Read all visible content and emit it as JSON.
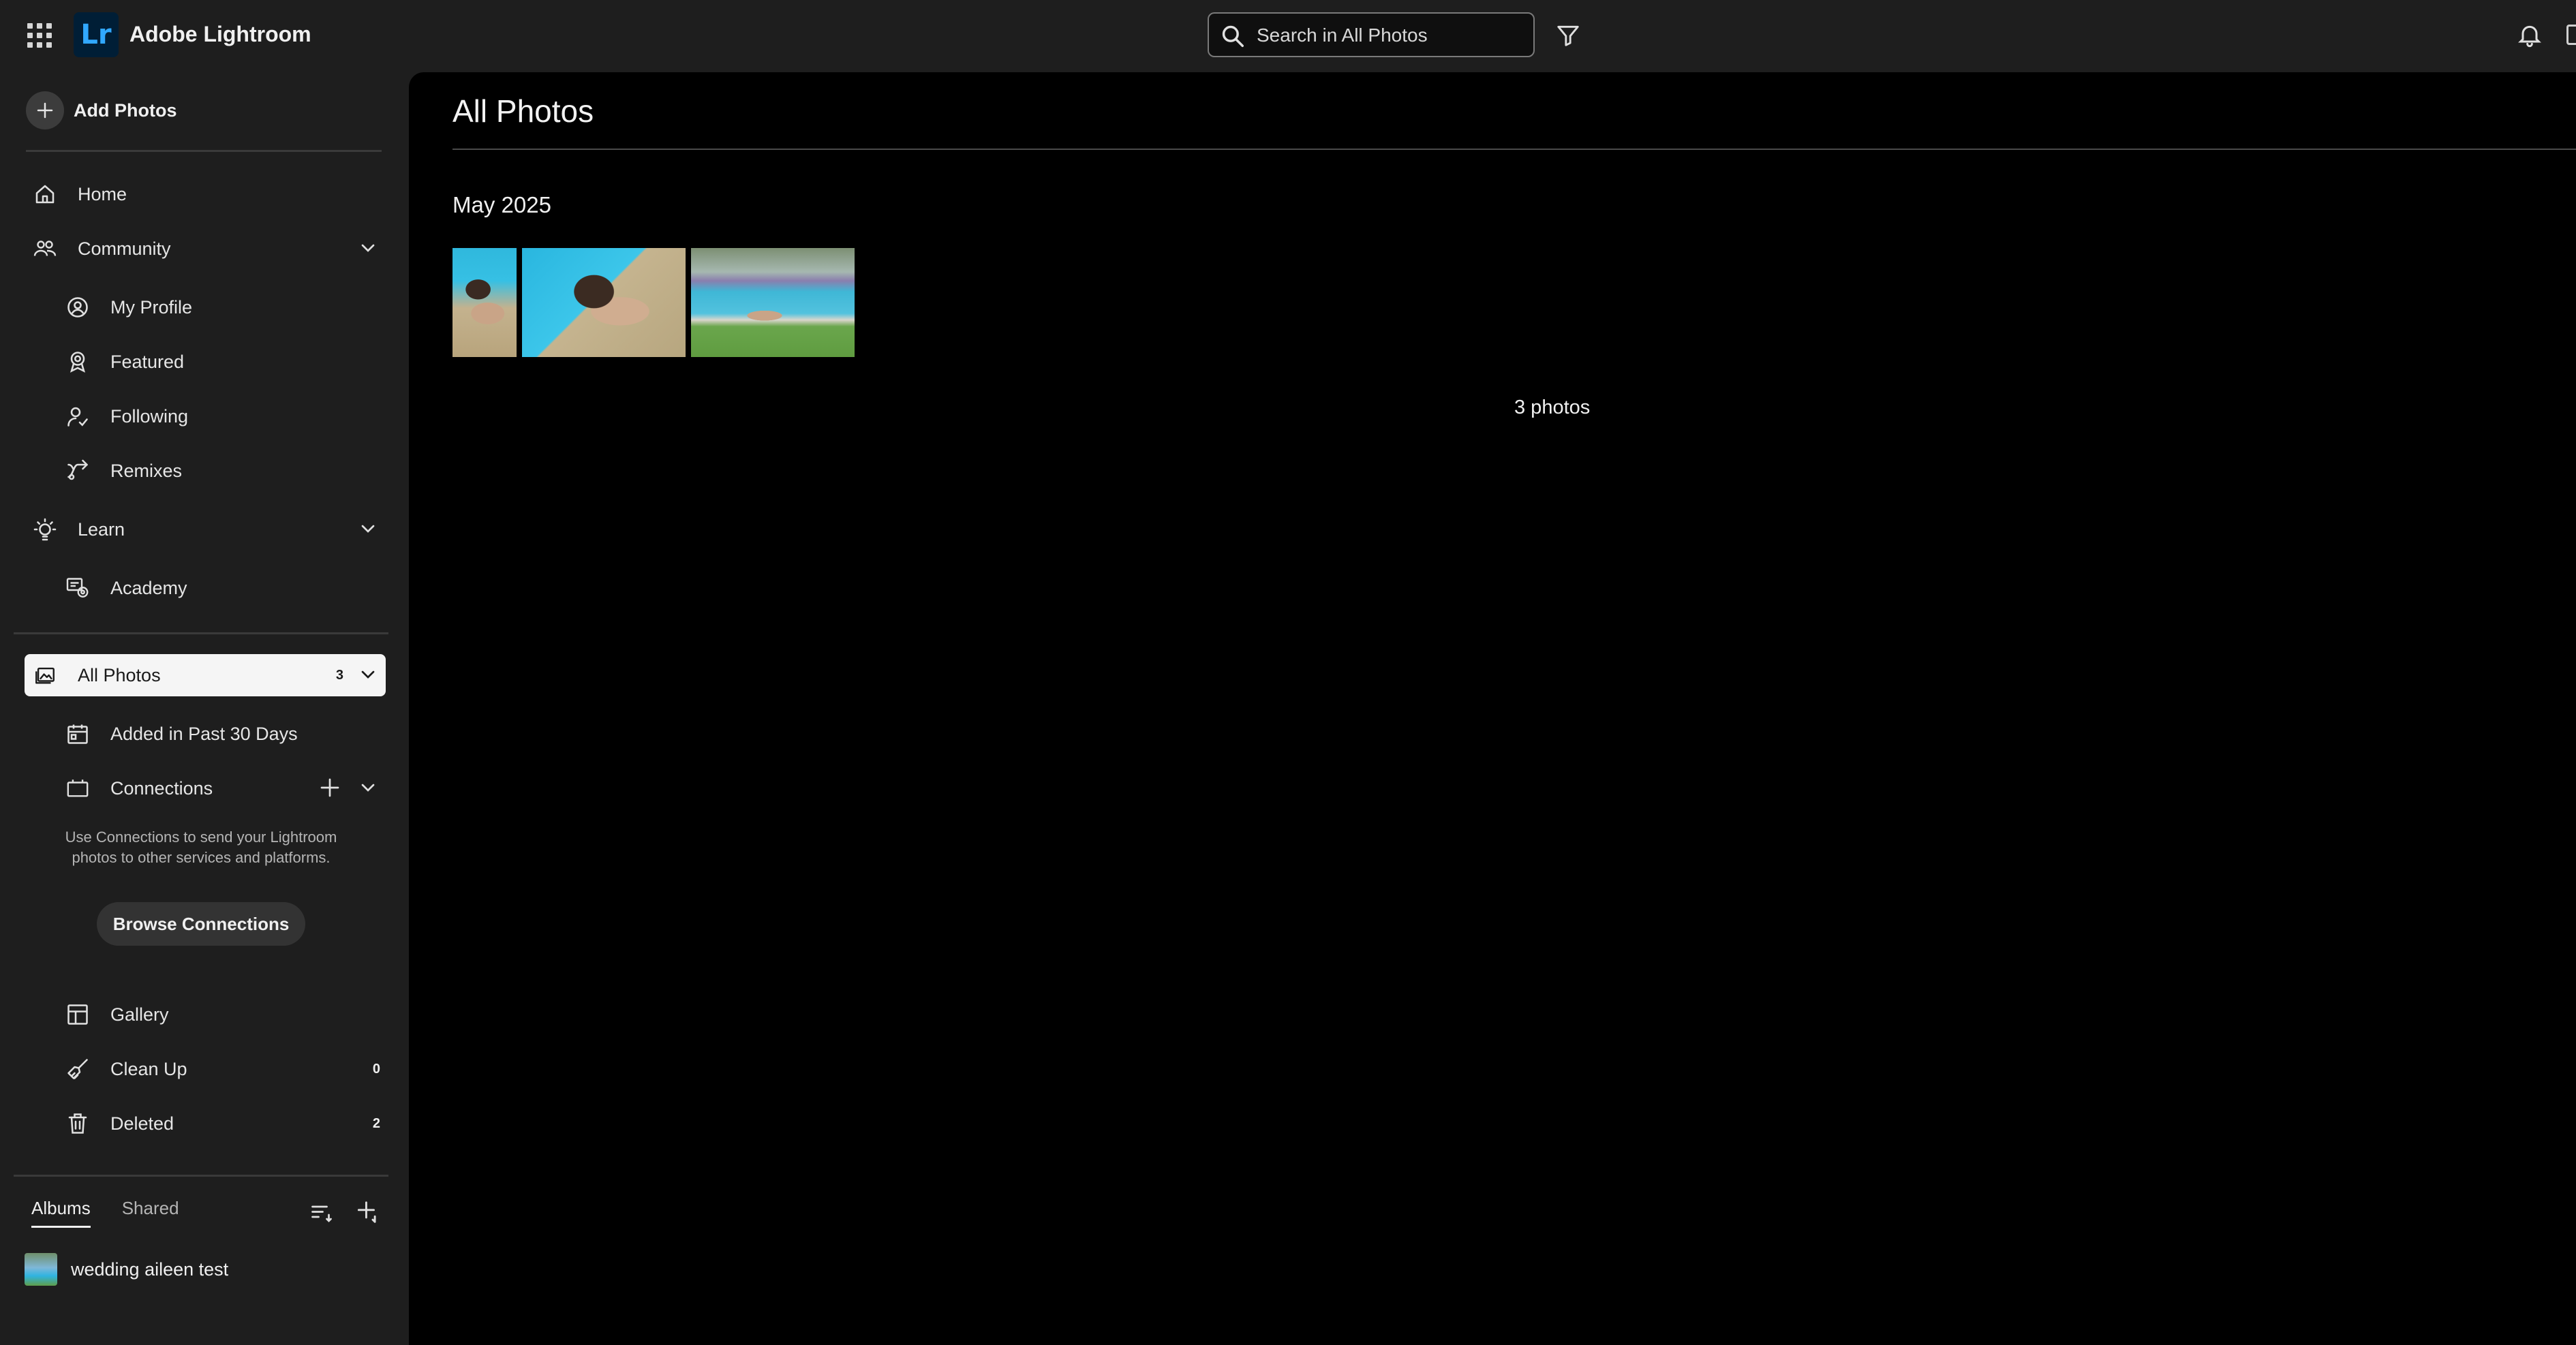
{
  "app": {
    "title": "Adobe Lightroom",
    "logo_text": "Lr"
  },
  "search": {
    "placeholder": "Search in All Photos"
  },
  "sidebar": {
    "add_photos": "Add Photos",
    "nav": {
      "home": "Home",
      "community": "Community",
      "my_profile": "My Profile",
      "featured": "Featured",
      "following": "Following",
      "remixes": "Remixes",
      "learn": "Learn",
      "academy": "Academy"
    },
    "library": {
      "all_photos": "All Photos",
      "all_photos_count": "3",
      "added_past_30": "Added in Past 30 Days",
      "connections": "Connections",
      "connections_note": "Use Connections to send your Lightroom photos to other services and platforms.",
      "browse_connections": "Browse Connections",
      "gallery": "Gallery",
      "clean_up": "Clean Up",
      "clean_up_count": "0",
      "deleted": "Deleted",
      "deleted_count": "2"
    },
    "albums": {
      "tabs": [
        "Albums",
        "Shared"
      ],
      "active_tab": "Albums",
      "items": [
        {
          "name": "wedding aileen test"
        }
      ]
    }
  },
  "main": {
    "title": "All Photos",
    "groups": [
      {
        "heading": "May 2025",
        "photo_count": 3
      }
    ],
    "footer_count": "3 photos"
  },
  "colors": {
    "app_bg": "#1e1e1e",
    "content_bg": "#000000",
    "selected_bg": "#f5f5f5",
    "logo_bg": "#001e36",
    "logo_fg": "#31a8ff"
  }
}
